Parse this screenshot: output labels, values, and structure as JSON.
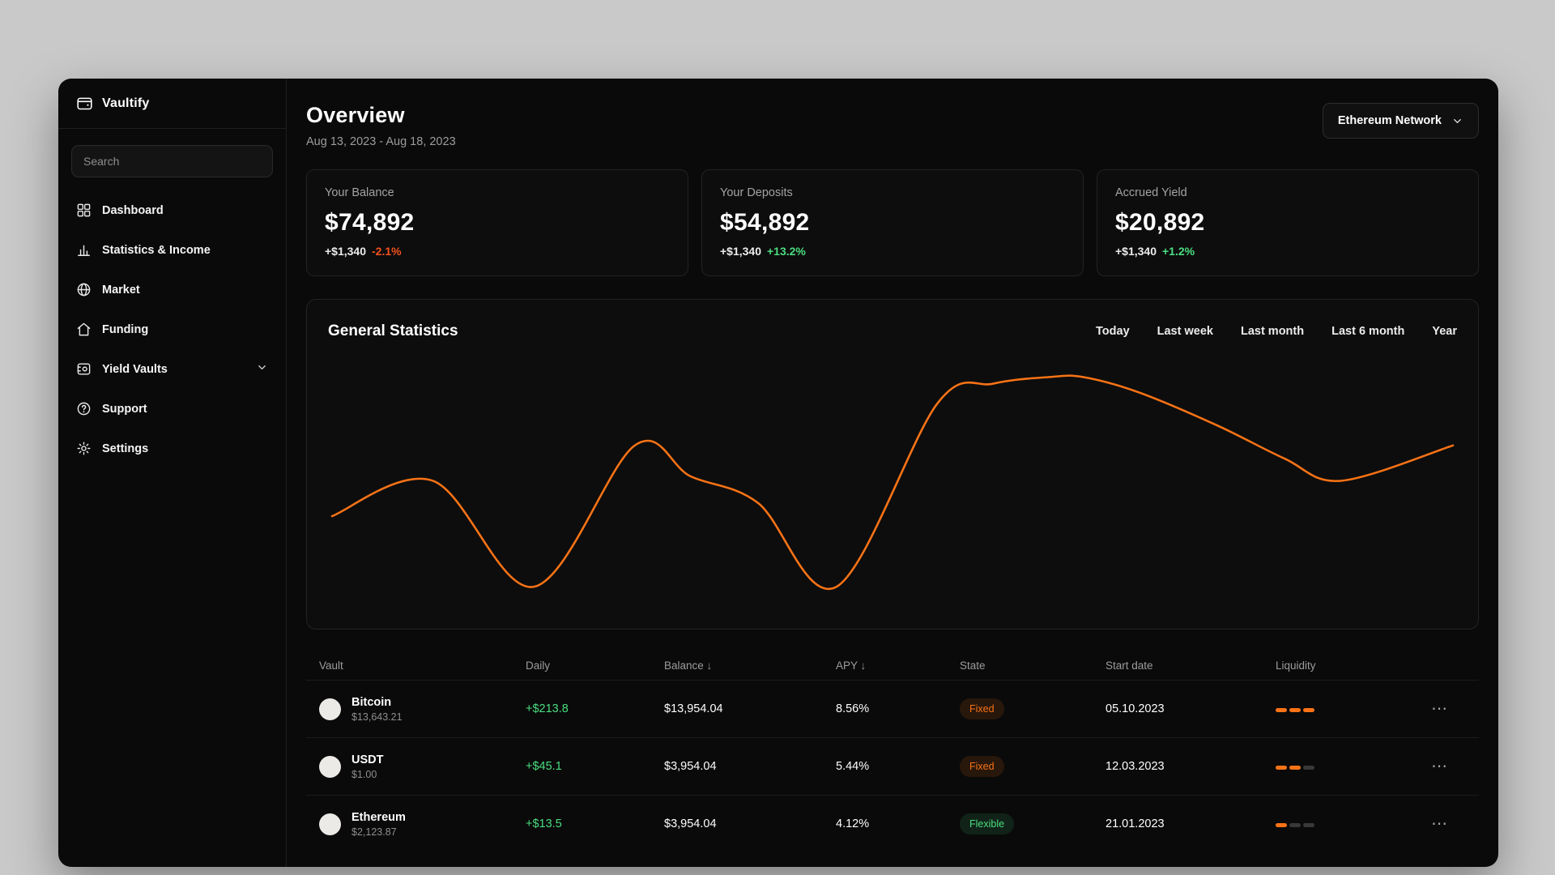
{
  "colors": {
    "accent": "#f97316",
    "positive": "#4ade80",
    "negative": "#f4511e",
    "background": "#c9c9c9",
    "surface": "#0a0a0a"
  },
  "icons": {
    "ellipsis": "⋯"
  },
  "sidebar": {
    "logo_text": "Vaultify",
    "search_placeholder": "Search",
    "items": [
      {
        "label": "Dashboard",
        "icon": "dashboard-icon"
      },
      {
        "label": "Statistics & Income",
        "icon": "bar-chart-icon"
      },
      {
        "label": "Market",
        "icon": "globe-icon"
      },
      {
        "label": "Funding",
        "icon": "home-icon"
      },
      {
        "label": "Yield Vaults",
        "icon": "vault-icon",
        "chevron": true
      },
      {
        "label": "Support",
        "icon": "support-icon"
      },
      {
        "label": "Settings",
        "icon": "settings-icon"
      }
    ]
  },
  "header": {
    "title": "Overview",
    "date_range": "Aug 13, 2023 - Aug 18, 2023",
    "network_label": "Ethereum Network"
  },
  "stats": [
    {
      "label": "Your Balance",
      "value": "$74,892",
      "delta": "+$1,340",
      "pct": "-2.1%",
      "direction": "down"
    },
    {
      "label": "Your Deposits",
      "value": "$54,892",
      "delta": "+$1,340",
      "pct": "+13.2%",
      "direction": "up"
    },
    {
      "label": "Accrued Yield",
      "value": "$20,892",
      "delta": "+$1,340",
      "pct": "+1.2%",
      "direction": "up"
    }
  ],
  "chart": {
    "title": "General Statistics",
    "filters": [
      "Today",
      "Last week",
      "Last month",
      "Last 6 month",
      "Year"
    ]
  },
  "chart_data": {
    "type": "line",
    "title": "General Statistics",
    "x": [
      0,
      9,
      18,
      27,
      32,
      38,
      45,
      54,
      59,
      64,
      67,
      72,
      79,
      85,
      90,
      100
    ],
    "values": [
      32,
      48,
      0,
      64,
      50,
      38,
      0,
      83,
      92,
      95,
      95,
      88,
      73,
      58,
      48,
      64
    ],
    "line_color": "#f97316",
    "xlabel": "",
    "ylabel": "",
    "ylim": [
      0,
      100
    ],
    "grid": false,
    "legend": "none"
  },
  "table": {
    "headers": [
      "Vault",
      "Daily",
      "Balance ↓",
      "APY ↓",
      "State",
      "Start date",
      "Liquidity"
    ],
    "rows": [
      {
        "name": "Bitcoin",
        "price": "$13,643.21",
        "daily": "+$213.8",
        "balance": "$13,954.04",
        "apy": "8.56%",
        "state": "Fixed",
        "state_type": "fixed",
        "start_date": "05.10.2023",
        "liquidity": 3
      },
      {
        "name": "USDT",
        "price": "$1.00",
        "daily": "+$45.1",
        "balance": "$3,954.04",
        "apy": "5.44%",
        "state": "Fixed",
        "state_type": "fixed",
        "start_date": "12.03.2023",
        "liquidity": 2
      },
      {
        "name": "Ethereum",
        "price": "$2,123.87",
        "daily": "+$13.5",
        "balance": "$3,954.04",
        "apy": "4.12%",
        "state": "Flexible",
        "state_type": "flexible",
        "start_date": "21.01.2023",
        "liquidity": 1
      }
    ]
  }
}
